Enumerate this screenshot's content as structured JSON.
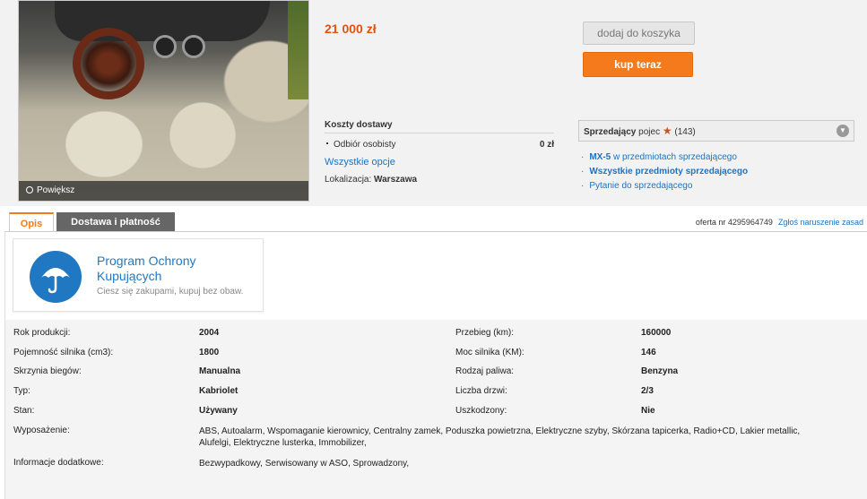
{
  "photo": {
    "zoom_label": "Powiększ"
  },
  "price": "21 000 zł",
  "buttons": {
    "add_to_cart": "dodaj do koszyka",
    "buy_now": "kup teraz"
  },
  "shipping": {
    "heading": "Koszty dostawy",
    "option_label": "Odbiór osobisty",
    "option_price": "0 zł",
    "all_options": "Wszystkie opcje",
    "location_label": "Lokalizacja:",
    "location_value": "Warszawa"
  },
  "seller": {
    "label": "Sprzedający",
    "name": "pojec",
    "rating": "(143)",
    "link_model": "MX-5",
    "link_model_suffix": " w przedmiotach sprzedającego",
    "link_all": "Wszystkie przedmioty sprzedającego",
    "link_question": "Pytanie do sprzedającego"
  },
  "tabs": [
    {
      "label": "Opis"
    },
    {
      "label": "Dostawa i płatność"
    }
  ],
  "offer": {
    "number": "oferta nr 4295964749",
    "report": "Zgłoś naruszenie zasad"
  },
  "protection": {
    "title": "Program Ochrony Kupujących",
    "subtitle": "Ciesz się zakupami, kupuj bez obaw."
  },
  "specs": {
    "year_label": "Rok produkcji:",
    "year_value": "2004",
    "mileage_label": "Przebieg (km):",
    "mileage_value": "160000",
    "engine_label": "Pojemność silnika (cm3):",
    "engine_value": "1800",
    "power_label": "Moc silnika (KM):",
    "power_value": "146",
    "gearbox_label": "Skrzynia biegów:",
    "gearbox_value": "Manualna",
    "fuel_label": "Rodzaj paliwa:",
    "fuel_value": "Benzyna",
    "type_label": "Typ:",
    "type_value": "Kabriolet",
    "doors_label": "Liczba drzwi:",
    "doors_value": "2/3",
    "condition_label": "Stan:",
    "condition_value": "Używany",
    "damaged_label": "Uszkodzony:",
    "damaged_value": "Nie",
    "equipment_label": "Wyposażenie:",
    "equipment_line1": "ABS, Autoalarm, Wspomaganie kierownicy, Centralny zamek, Poduszka powietrzna, Elektryczne szyby, Skórzana tapicerka, Radio+CD, Lakier metallic,",
    "equipment_line2": "Alufelgi, Elektryczne lusterka, Immobilizer,",
    "extra_label": "Informacje dodatkowe:",
    "extra_value": "Bezwypadkowy, Serwisowany w ASO, Sprowadzony,"
  }
}
